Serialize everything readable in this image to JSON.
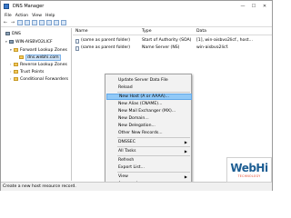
{
  "window": {
    "title": "DNS Manager",
    "controls": [
      "—",
      "☐",
      "✕"
    ]
  },
  "menu": [
    "File",
    "Action",
    "View",
    "Help"
  ],
  "tree": [
    {
      "label": "DNS",
      "level": 0,
      "type": "server",
      "expander": ""
    },
    {
      "label": "WIN-AISBVO2LICF",
      "level": 1,
      "type": "server",
      "expander": "▾"
    },
    {
      "label": "Forward Lookup Zones",
      "level": 2,
      "type": "folder",
      "expander": "▾"
    },
    {
      "label": "dns.webhi.com",
      "level": 3,
      "type": "zone",
      "expander": "",
      "selected": true
    },
    {
      "label": "Reverse Lookup Zones",
      "level": 2,
      "type": "folder",
      "expander": "›"
    },
    {
      "label": "Trust Points",
      "level": 2,
      "type": "folder",
      "expander": "›"
    },
    {
      "label": "Conditional Forwarders",
      "level": 2,
      "type": "folder",
      "expander": "›"
    }
  ],
  "list": {
    "columns": [
      "Name",
      "Type",
      "Data"
    ],
    "rows": [
      [
        "(same as parent folder)",
        "Start of Authority (SOA)",
        "[1], win-aisbvo2licf., host..."
      ],
      [
        "(same as parent folder)",
        "Name Server (NS)",
        "win-aisbvo2licf."
      ]
    ]
  },
  "context_menu": {
    "items": [
      {
        "label": "Update Server Data File"
      },
      {
        "label": "Reload"
      },
      {
        "label": "New Host (A or AAAA)...",
        "highlighted": true
      },
      {
        "label": "New Alias (CNAME)..."
      },
      {
        "label": "New Mail Exchanger (MX)..."
      },
      {
        "label": "New Domain..."
      },
      {
        "label": "New Delegation..."
      },
      {
        "label": "Other New Records..."
      },
      {
        "label": "DNSSEC",
        "submenu": true
      },
      {
        "label": "All Tasks",
        "submenu": true
      },
      {
        "label": "Refresh"
      },
      {
        "label": "Export List..."
      },
      {
        "label": "View",
        "submenu": true
      },
      {
        "label": "Arrange Icons",
        "submenu": true
      }
    ]
  },
  "status": "Create a new host resource record.",
  "watermark": {
    "logo": "WebHi",
    "sub": "TECHNOLOGY"
  }
}
